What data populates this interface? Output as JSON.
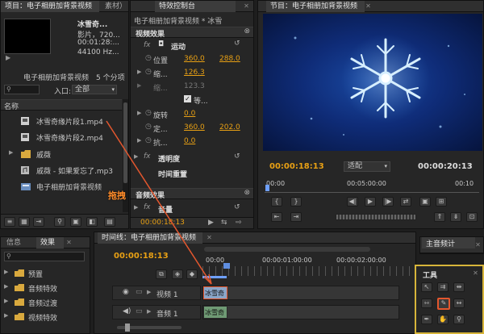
{
  "project": {
    "tab_label": "项目：电子相册加背景视频",
    "tab2_label": "素材）",
    "clip_name": "冰雪奇...",
    "clip_info": [
      "影片，720...",
      "00:01:28:...",
      "44100 Hz..."
    ],
    "title": "电子相册加背景视频",
    "item_count": "5 个分项",
    "entry_label": "入口:",
    "entry_value": "全部",
    "column_name": "名称",
    "items": [
      {
        "icon": "video-file-icon",
        "label": "冰雪奇缘片段1.mp4"
      },
      {
        "icon": "video-file-icon",
        "label": "冰雪奇缘片段2.mp4"
      },
      {
        "icon": "folder-icon",
        "label": "戚薇"
      },
      {
        "icon": "audio-file-icon",
        "label": "戚薇 - 如果爱忘了.mp3"
      },
      {
        "icon": "sequence-icon",
        "label": "电子相册加背景视频"
      }
    ]
  },
  "effect_controls": {
    "tab_label": "特效控制台",
    "sequence_label": "电子相册加背景视频 * 冰雪",
    "section_video": "视频效果",
    "motion": "运动",
    "position_label": "位置",
    "position_x": "360.0",
    "position_y": "288.0",
    "scale_label": "缩...",
    "scale_value": "126.3",
    "scale_width_label": "缩...",
    "scale_width_value": "123.3",
    "uniform_label": "等...",
    "rotation_label": "旋转",
    "rotation_value": "0.0",
    "anchor_label": "定...",
    "anchor_x": "360.0",
    "anchor_y": "202.0",
    "flicker_label": "抗...",
    "flicker_value": "0.0",
    "opacity": "透明度",
    "time_remap": "时间重置",
    "section_audio": "音频效果",
    "volume": "音量",
    "timecode": "00:00:18:13"
  },
  "program": {
    "tab_label": "节目：电子相册加背景视频",
    "timecode_left": "00:00:18:13",
    "fit_label": "适配",
    "timecode_right": "00:00:20:13",
    "ruler": [
      "00:00",
      "00:05:00:00",
      "00:10"
    ]
  },
  "info_panel": {
    "tab_info": "信息",
    "tab_effects": "效果",
    "items": [
      {
        "label": "预置"
      },
      {
        "label": "音频特效"
      },
      {
        "label": "音频过渡"
      },
      {
        "label": "视频特效"
      }
    ]
  },
  "timeline": {
    "tab_label": "时间线：电子相册加背景视频",
    "timecode": "00:00:18:13",
    "ruler": [
      "00:00",
      "00:00:01:00:00",
      "00:00:02:00:00"
    ],
    "video_track": "视频 1",
    "audio_track": "音频 1",
    "video_clip": "冰雪奇",
    "audio_clip": "冰雪奇"
  },
  "audio_master": {
    "tab_label": "主音频计"
  },
  "tools": {
    "title": "工具"
  },
  "annotation": {
    "drag_label": "拖拽"
  }
}
